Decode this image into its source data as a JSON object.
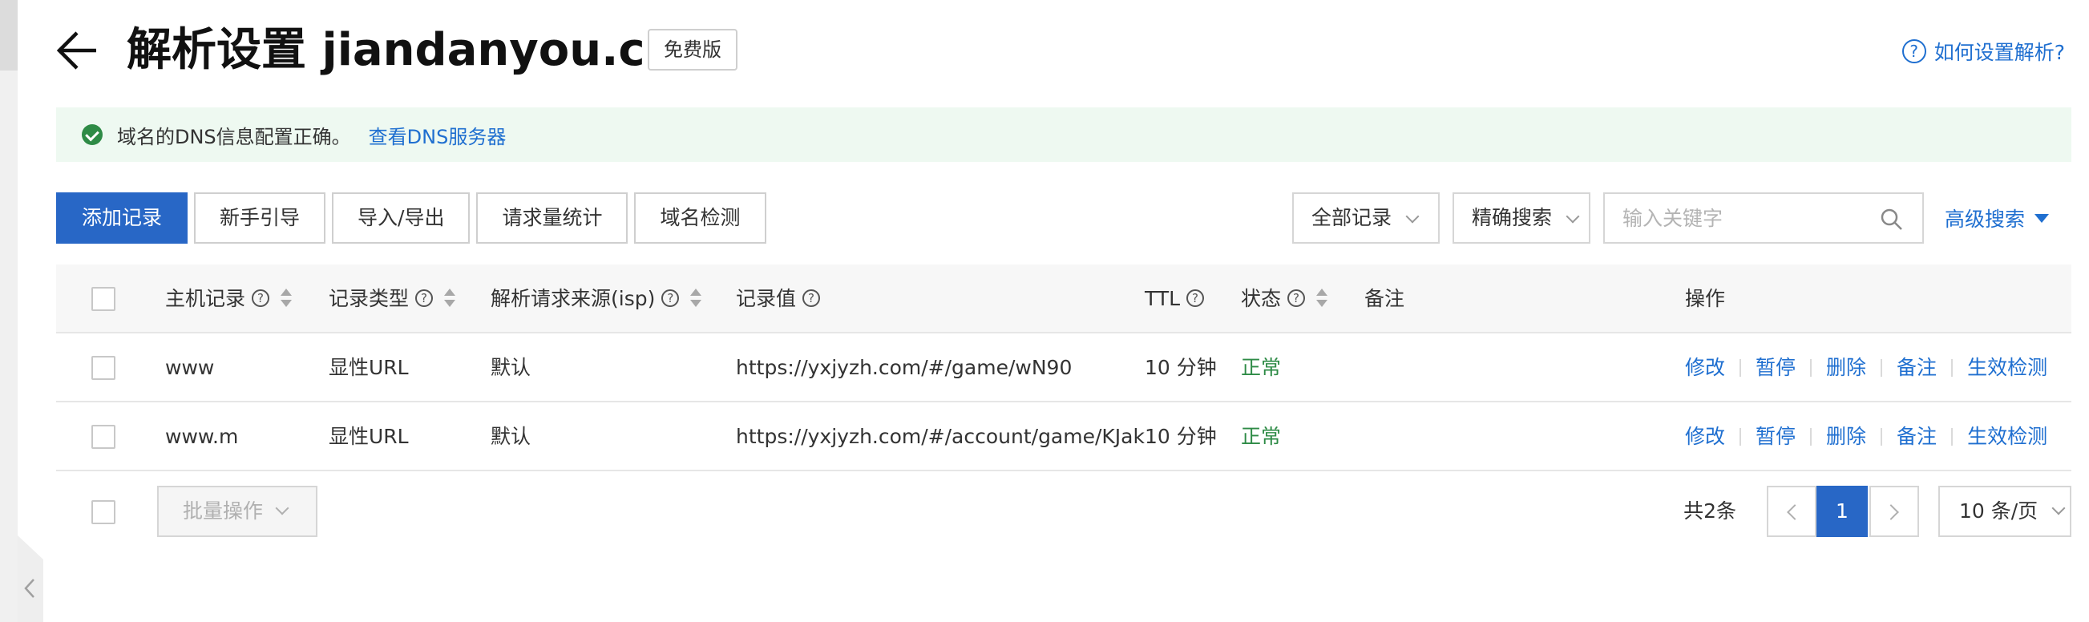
{
  "header": {
    "title": "解析设置 jiandanyou.cn",
    "edition_badge": "免费版",
    "help_link": "如何设置解析?"
  },
  "notice": {
    "message": "域名的DNS信息配置正确。",
    "link": "查看DNS服务器"
  },
  "toolbar": {
    "buttons": [
      "添加记录",
      "新手引导",
      "导入/导出",
      "请求量统计",
      "域名检测"
    ],
    "filter_select": "全部记录",
    "search_mode": "精确搜索",
    "search_placeholder": "输入关键字",
    "advanced_search": "高级搜索"
  },
  "table": {
    "columns": [
      "主机记录",
      "记录类型",
      "解析请求来源(isp)",
      "记录值",
      "TTL",
      "状态",
      "备注",
      "操作"
    ],
    "rows": [
      {
        "host": "www",
        "type": "显性URL",
        "isp": "默认",
        "value": "https://yxjyzh.com/#/game/wN90",
        "ttl": "10 分钟",
        "status": "正常",
        "remark": ""
      },
      {
        "host": "www.m",
        "type": "显性URL",
        "isp": "默认",
        "value": "https://yxjyzh.com/#/account/game/KJak",
        "ttl": "10 分钟",
        "status": "正常",
        "remark": ""
      }
    ],
    "row_actions": [
      "修改",
      "暂停",
      "删除",
      "备注",
      "生效检测"
    ]
  },
  "footer": {
    "batch_label": "批量操作",
    "total": "共2条",
    "current_page": "1",
    "page_size": "10 条/页"
  },
  "colors": {
    "primary": "#2867c6",
    "link": "#1f6fd0",
    "success": "#2e8b46",
    "notice_bg": "#eef9f1"
  }
}
